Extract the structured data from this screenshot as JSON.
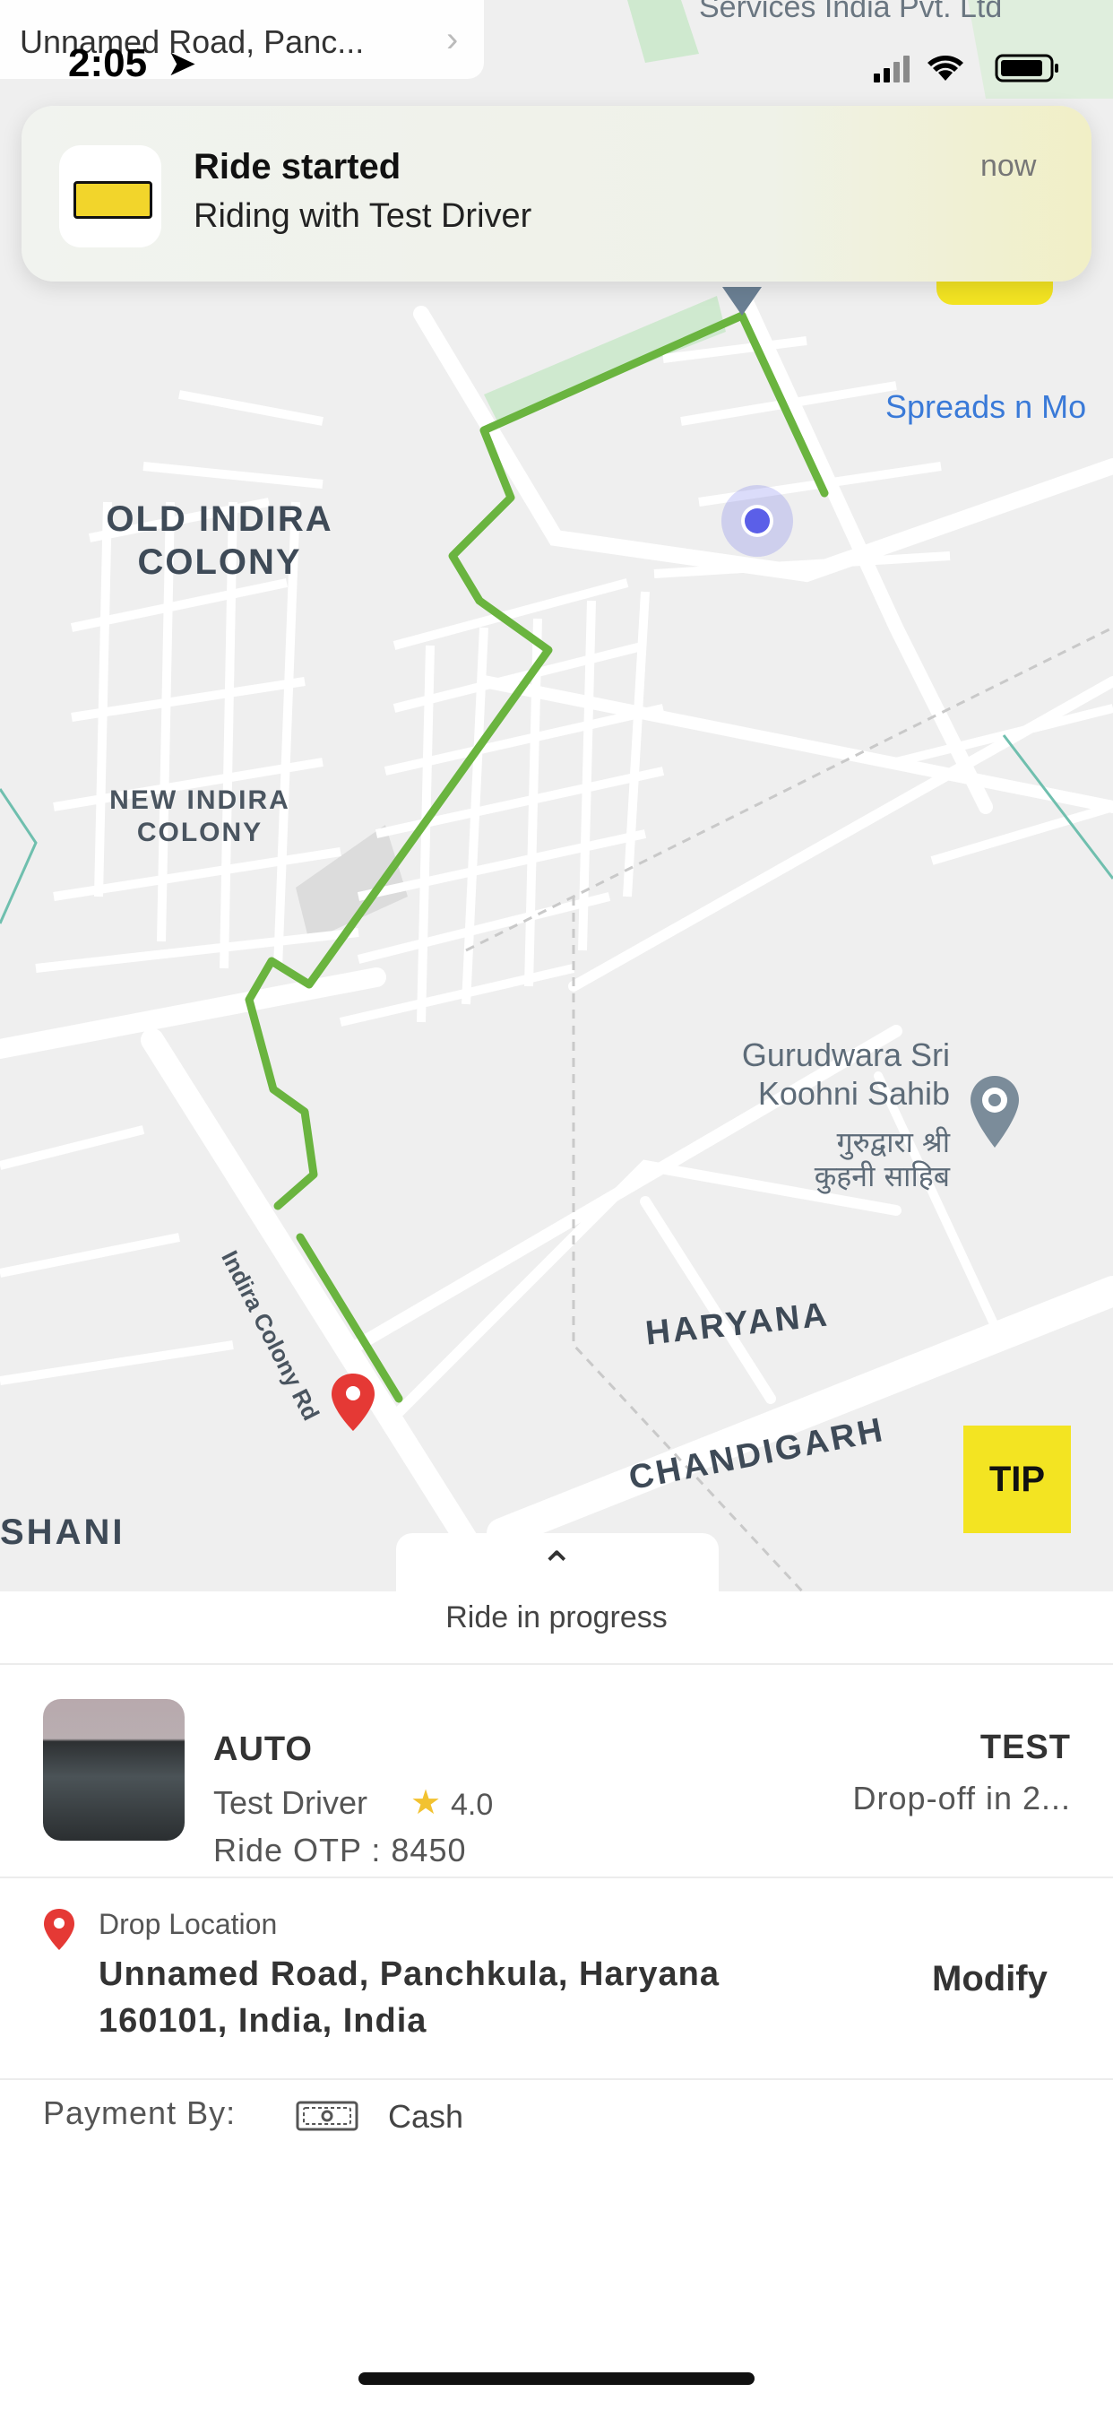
{
  "status_bar": {
    "time": "2:05",
    "location_glyph": "➤"
  },
  "address_chip": {
    "text": "Unnamed Road, Panc...",
    "chevron": "›"
  },
  "notification": {
    "title": "Ride started",
    "body": "Riding with Test Driver",
    "time": "now"
  },
  "map": {
    "labels": {
      "services": "Services India Pvt. Ltd",
      "spreads": "Spreads n Mo",
      "old_colony": "OLD INDIRA\nCOLONY",
      "new_colony": "NEW INDIRA\nCOLONY",
      "road": "Indira Colony Rd",
      "gurudwara": "Gurudwara Sri\nKoohni Sahib",
      "gurudwara_hindi": "गुरुद्वारा श्री\nकुहनी साहिब",
      "haryana": "HARYANA",
      "chandigarh": "CHANDIGARH",
      "shani": "SHANI"
    },
    "route_color": "#6ab43f",
    "location_dot_color": "#5b5fe8",
    "destination_pin_color": "#e53935"
  },
  "tip_button": {
    "label": "TIP",
    "color": "#f3e422"
  },
  "sheet": {
    "handle_icon": "⌃",
    "status": "Ride in progress",
    "vehicle_type": "AUTO",
    "driver_name": "Test Driver",
    "rating_star": "★",
    "rating": "4.0",
    "otp": "Ride OTP : 8450",
    "plate": "TEST",
    "eta": "Drop-off in 2...",
    "drop_caption": "Drop Location",
    "drop_address": "Unnamed Road, Panchkula, Haryana 160101, India, India",
    "modify_label": "Modify",
    "payment_label": "Payment By:",
    "payment_method": "Cash"
  }
}
